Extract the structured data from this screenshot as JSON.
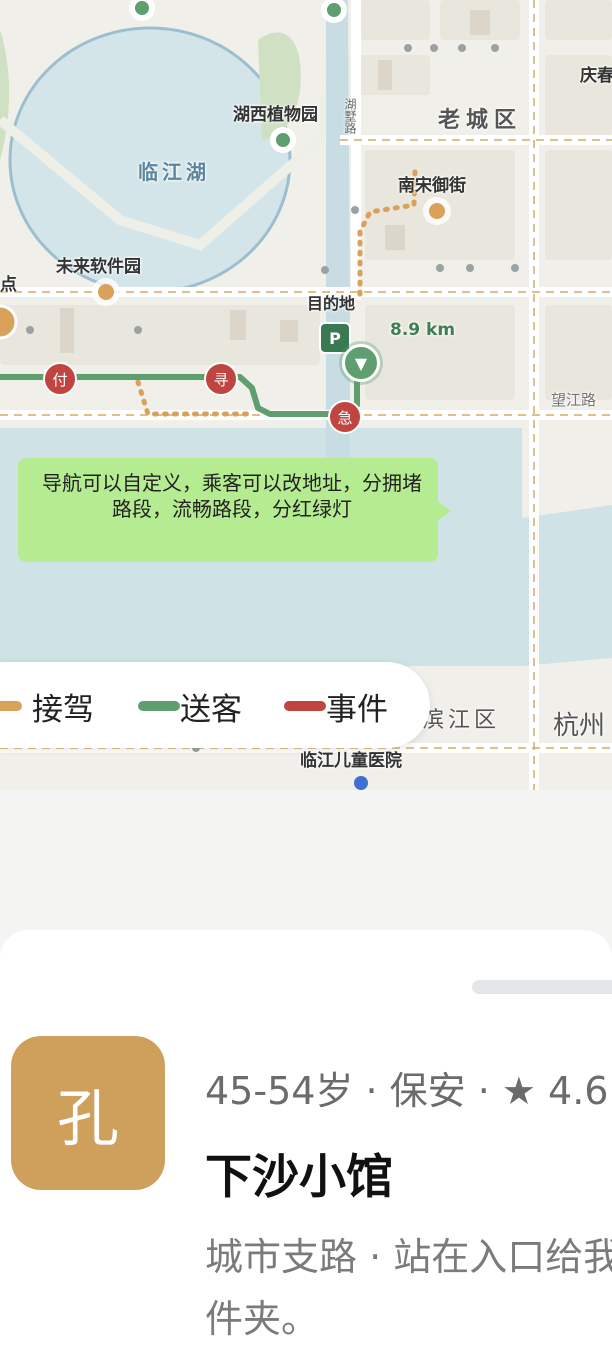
{
  "map": {
    "labels": {
      "lake": "临江湖",
      "botanical_garden": "湖西植物园",
      "old_town": "老城区",
      "song_street": "南宋御街",
      "software_park": "未来软件园",
      "destination": "目的地",
      "distance": "8.9 km",
      "wangjiang_road": "望江路",
      "lake_road": "湖墅路",
      "qingchun": "庆春",
      "start_point": "点",
      "binjiang": "滨江区",
      "hangzhou": "杭州",
      "hospital": "临江儿童医院"
    },
    "markers": {
      "pay": "付",
      "seek": "寻",
      "urgent": "急"
    },
    "callout": "导航可以自定义，乘客可以改地址，分拥堵路段，流畅路段，分红绿灯",
    "legend": [
      {
        "label": "接驾",
        "color": "#d9a15a"
      },
      {
        "label": "送客",
        "color": "#5f9e6e"
      },
      {
        "label": "事件",
        "color": "#c0443f"
      }
    ]
  },
  "card": {
    "avatar_text": "孔",
    "meta": "45-54岁 · 保安 · ★ 4.6",
    "name": "下沙小馆",
    "description": "城市支路 · 站在入口给我发文件夹。"
  }
}
